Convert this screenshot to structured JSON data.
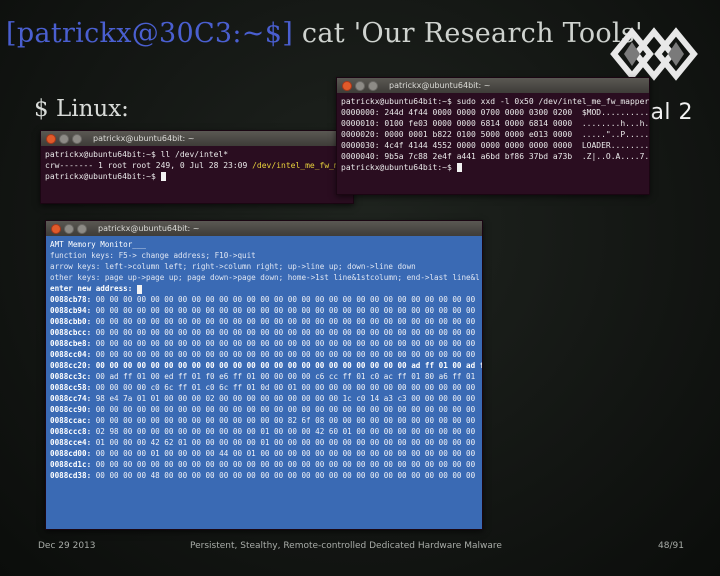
{
  "slide": {
    "title_prompt": "[patrickx@30C3:~$]",
    "title_command": " cat 'Our Research Tools'",
    "subheading": "$ Linux:",
    "logo_text": "Saal 2",
    "footer_date": "Dec 29 2013",
    "footer_title": "Persistent, Stealthy, Remote-controlled Dedicated Hardware Malware",
    "footer_page": "48/91"
  },
  "terminals": {
    "window_title": "patrickx@ubuntu64bit: ~",
    "term1": {
      "line1": "patrickx@ubuntu64bit:~$ ll /dev/intel*",
      "line2_prefix": "crw------- 1 root root 249, 0 Jul 28 23:09 ",
      "line2_highlight": "/dev/intel_me_fw_mapper",
      "line3": "patrickx@ubuntu64bit:~$ "
    },
    "term2": {
      "lines": [
        "patrickx@ubuntu64bit:~$ sudo xxd -l 0x50 /dev/intel_me_fw_mapper",
        "0000000: 244d 4f44 0000 0000 0700 0000 0300 0200  $MOD..........",
        "0000010: 0100 fe03 0000 0000 6814 0000 6814 0000  ........h...h...",
        "0000020: 0000 0001 b822 0100 5000 0000 e013 0000  .....\"..P.......",
        "0000030: 4c4f 4144 4552 0000 0000 0000 0000 0000  LOADER..........",
        "0000040: 9b5a 7c88 2e4f a441 a6bd bf86 37bd a73b  .Z|..O.A....7..;"
      ],
      "prompt": "patrickx@ubuntu64bit:~$ "
    },
    "term3": {
      "title": "AMT Memory Monitor___",
      "help1": "function keys: F5-> change address; F10->quit",
      "help2": "arrow keys: left->column left; right->column right; up->line up; down->line down",
      "help3": "other keys: page up->page up; page down->page down; home->1st line&1stcolumn; end->last line&l",
      "address_prompt": "enter new address: ",
      "rows": [
        {
          "addr": "0088cb78:",
          "bytes": "00 00 00 00 00 00 00 00 00 00 00 00 00 00 00 00 00 00 00 00 00 00 00 00 00 00 00 00",
          "bold": false
        },
        {
          "addr": "0088cb94:",
          "bytes": "00 00 00 00 00 00 00 00 00 00 00 00 00 00 00 00 00 00 00 00 00 00 00 00 00 00 00 00",
          "bold": false
        },
        {
          "addr": "0088cbb0:",
          "bytes": "00 00 00 00 00 00 00 00 00 00 00 00 00 00 00 00 00 00 00 00 00 00 00 00 00 00 00 00",
          "bold": false
        },
        {
          "addr": "0088cbcc:",
          "bytes": "00 00 00 00 00 00 00 00 00 00 00 00 00 00 00 00 00 00 00 00 00 00 00 00 00 00 00 00",
          "bold": false
        },
        {
          "addr": "0088cbe8:",
          "bytes": "00 00 00 00 00 00 00 00 00 00 00 00 00 00 00 00 00 00 00 00 00 00 00 00 00 00 00 00",
          "bold": false
        },
        {
          "addr": "0088cc04:",
          "bytes": "00 00 00 00 00 00 00 00 00 00 00 00 00 00 00 00 00 00 00 00 00 00 00 00 00 00 00 00",
          "bold": false
        },
        {
          "addr": "0088cc20:",
          "bytes": "00 00 00 00 00 00 00 00 00 00 00 00 00 00 00 00 00 00 00 00 00 00 00 ad ff 01 00 ad ff 01",
          "bold": true
        },
        {
          "addr": "0088cc3c:",
          "bytes": "00 ad ff 01 00 ed ff 01 f0 e6 ff 01 00 00 00 00 c6 cc ff 01 c0 ac ff 01 80 a6 ff 01",
          "bold": false
        },
        {
          "addr": "0088cc58:",
          "bytes": "00 00 00 00 c0 6c ff 01 c0 6c ff 01 0d 00 01 00 00 00 00 00 00 00 00 00 00 00 00 00",
          "bold": false
        },
        {
          "addr": "0088cc74:",
          "bytes": "98 e4 7a 01 01 00 00 00 02 00 00 00 00 00 00 00 00 00 1c c0 14 a3 c3 00 00 00 00 00",
          "bold": false
        },
        {
          "addr": "0088cc90:",
          "bytes": "00 00 00 00 00 00 00 00 00 00 00 00 00 00 00 00 00 00 00 00 00 00 00 00 00 00 00 00",
          "bold": false
        },
        {
          "addr": "0088ccac:",
          "bytes": "00 00 00 00 00 00 00 00 00 00 00 00 00 00 82 6f 08 00 00 00 00 00 00 00 00 00 00 00",
          "bold": false
        },
        {
          "addr": "0088ccc8:",
          "bytes": "02 98 00 00 00 00 00 00 00 00 00 00 01 00 00 00 42 60 01 00 00 00 00 00 00 00 00 00",
          "bold": false
        },
        {
          "addr": "0088cce4:",
          "bytes": "01 00 00 00 42 62 01 00 00 00 00 00 01 00 00 00 00 00 00 00 00 00 00 00 00 00 00 00",
          "bold": false
        },
        {
          "addr": "0088cd00:",
          "bytes": "00 00 00 00 01 00 00 00 00 44 00 01 00 00 00 00 00 00 00 00 00 00 00 00 00 00 00 00",
          "bold": false
        },
        {
          "addr": "0088cd1c:",
          "bytes": "00 00 00 00 00 00 00 00 00 00 00 00 00 00 00 00 00 00 00 00 00 00 00 00 00 00 00 00",
          "bold": false
        },
        {
          "addr": "0088cd38:",
          "bytes": "00 00 00 00 48 00 00 00 00 00 00 00 00 00 00 00 00 00 00 00 00 00 00 00 00 00 00 00",
          "bold": false
        }
      ]
    }
  }
}
